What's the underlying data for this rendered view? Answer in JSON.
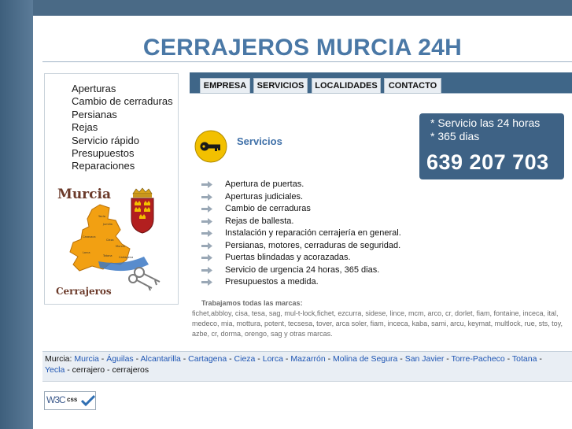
{
  "header": {
    "title": "CERRAJEROS MURCIA 24H"
  },
  "sidebar": {
    "items": [
      "Aperturas",
      "Cambio de cerraduras",
      "Persianas",
      "Rejas",
      "Servicio rápido",
      "Presupuestos",
      "Reparaciones"
    ],
    "map": {
      "title": "Murcia",
      "caption": "Cerrajeros"
    }
  },
  "nav": {
    "tabs": [
      "EMPRESA",
      "SERVICIOS",
      "LOCALIDADES",
      "CONTACTO"
    ]
  },
  "phone_box": {
    "line1": "* Servicio las 24 horas",
    "line2": "* 365 dias",
    "number": "639 207 703"
  },
  "section": {
    "title": "Servicios",
    "items": [
      "Apertura de puertas.",
      "Aperturas judiciales.",
      "Cambio de cerraduras",
      "Rejas de ballesta.",
      "Instalación y reparación cerrajería en general.",
      "Persianas, motores, cerraduras de seguridad.",
      "Puertas blindadas y acorazadas.",
      "Servicio de urgencia 24 horas, 365 dias.",
      "Presupuestos a medida."
    ]
  },
  "brands": {
    "title": "Trabajamos todas las marcas:",
    "text": "fichet,abbloy, cisa, tesa, sag, mul-t-lock,fichet, ezcurra, sidese, lince, mcm, arco, cr, dorlet, fiam, fontaine, inceca, ital, medeco, mia, mottura, potent, tecsesa, tover, arca soler, fiam, inceca, kaba, sami, arcu, keymat, multlock, rue, sts, toy, azbe, cr, dorma, orengo, sag y otras marcas."
  },
  "footer": {
    "prefix": "Murcia:",
    "links": [
      "Murcia",
      "Águilas",
      "Alcantarilla",
      "Cartagena",
      "Cieza",
      "Lorca",
      "Mazarrón",
      "Molina de Segura",
      "San Javier",
      "Torre-Pacheco",
      "Totana",
      "Yecla"
    ],
    "separator": " - ",
    "suffix_items": [
      "cerrajero",
      "cerrajeros"
    ]
  },
  "badge": {
    "w3c": "W3C",
    "css": "css"
  },
  "colors": {
    "accent": "#4a78a6",
    "nav": "#3f6688",
    "phone_box": "#3e6285",
    "link": "#1e55b3",
    "icon": "#f2c000"
  }
}
